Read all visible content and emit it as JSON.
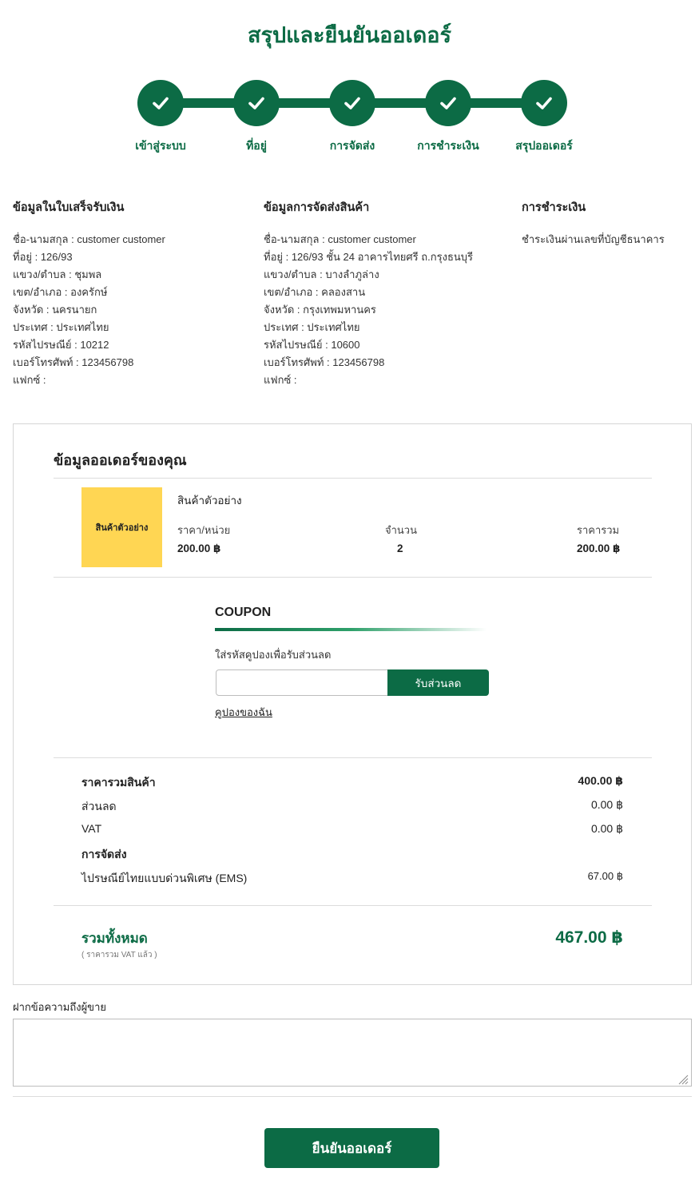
{
  "page": {
    "title": "สรุปและยืนยันออเดอร์"
  },
  "steps": [
    {
      "label": "เข้าสู่ระบบ",
      "done": true
    },
    {
      "label": "ที่อยู่",
      "done": true
    },
    {
      "label": "การจัดส่ง",
      "done": true
    },
    {
      "label": "การชำระเงิน",
      "done": true
    },
    {
      "label": "สรุปออเดอร์",
      "done": true
    }
  ],
  "billing": {
    "heading": "ข้อมูลในใบเสร็จรับเงิน",
    "lines": [
      "ชื่อ-นามสกุล : customer customer",
      "ที่อยู่ :  126/93",
      "แขวง/ตำบล : ชุมพล",
      "เขต/อำเภอ : องครักษ์",
      "จังหวัด : นครนายก",
      "ประเทศ : ประเทศไทย",
      "รหัสไปรษณีย์ : 10212",
      "เบอร์โทรศัพท์ : 123456798",
      "แฟกซ์ :"
    ]
  },
  "shipping": {
    "heading": "ข้อมูลการจัดส่งสินค้า",
    "lines": [
      "ชื่อ-นามสกุล : customer customer",
      "ที่อยู่ :  126/93 ชั้น 24 อาคารไทยศรี ถ.กรุงธนบุรี",
      "แขวง/ตำบล : บางลำภูล่าง",
      "เขต/อำเภอ : คลองสาน",
      "จังหวัด : กรุงเทพมหานคร",
      "ประเทศ : ประเทศไทย",
      "รหัสไปรษณีย์ : 10600",
      "เบอร์โทรศัพท์ : 123456798",
      "แฟกซ์ :"
    ]
  },
  "payment": {
    "heading": "การชำระเงิน",
    "lines": [
      "ชำระเงินผ่านเลขที่บัญชีธนาคาร"
    ]
  },
  "order": {
    "title": "ข้อมูลออเดอร์ของคุณ",
    "product": {
      "thumb_text": "สินค้าตัวอย่าง",
      "name": "สินค้าตัวอย่าง",
      "unit_price_label": "ราคา/หน่วย",
      "unit_price": "200.00 ฿",
      "qty_label": "จำนวน",
      "qty": "2",
      "total_label": "ราคารวม",
      "total": "200.00 ฿"
    },
    "coupon": {
      "title": "COUPON",
      "hint": "ใส่รหัสคูปองเพื่อรับส่วนลด",
      "input_value": "",
      "button": "รับส่วนลด",
      "my_coupons": "คูปองของฉัน"
    },
    "summary": {
      "subtotal_label": "ราคารวมสินค้า",
      "subtotal": "400.00 ฿",
      "discount_label": "ส่วนลด",
      "discount": "0.00 ฿",
      "vat_label": "VAT",
      "vat": "0.00 ฿",
      "shipping_heading": "การจัดส่ง",
      "shipping_method": "ไปรษณีย์ไทยแบบด่วนพิเศษ (EMS)",
      "shipping_cost": "67.00 ฿"
    },
    "grand_total": {
      "label": "รวมทั้งหมด",
      "note": "( ราคารวม VAT แล้ว )",
      "value": "467.00 ฿"
    }
  },
  "message": {
    "label": "ฝากข้อความถึงผู้ขาย",
    "value": ""
  },
  "confirm_button": "ยืนยันออเดอร์",
  "colors": {
    "brand_green": "#0c6b45",
    "thumb_yellow": "#ffd653"
  },
  "icons": {
    "step": "check-icon"
  }
}
